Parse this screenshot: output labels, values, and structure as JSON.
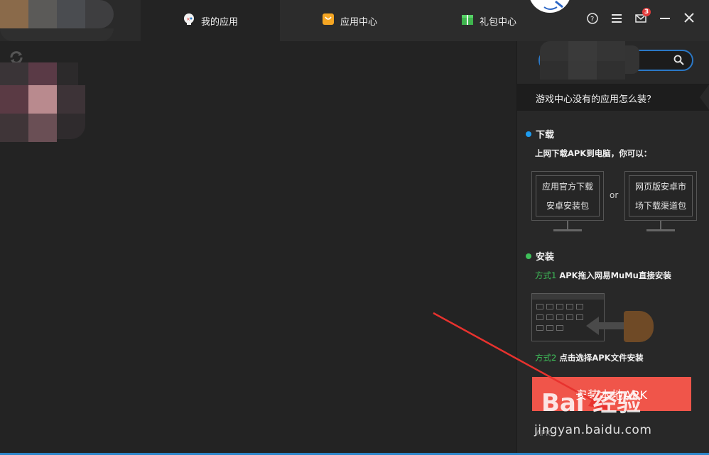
{
  "tabs": {
    "my_apps": "我的应用",
    "app_center": "应用中心",
    "gifts": "礼包中心"
  },
  "window_controls": {
    "mail_count": "3"
  },
  "right_panel": {
    "help_banner": "游戏中心没有的应用怎么装？",
    "download": {
      "title": "下载",
      "dot_color": "#1e9cf0",
      "subtitle": "上网下载APK到电脑，你可以：",
      "option1_line1": "应用官方下载",
      "option1_line2": "安卓安装包",
      "or": "or",
      "option2_line1": "网页版安卓市",
      "option2_line2": "场下载渠道包"
    },
    "install": {
      "title": "安装",
      "dot_color": "#3fc05a",
      "method1_label": "方式1",
      "method1_text": "APK拖入网易MuMu直接安装",
      "method2_label": "方式2",
      "method2_text": "点击选择APK文件安装"
    },
    "install_button": "安装本地APK",
    "footnote": "APK"
  },
  "watermark": {
    "logo": "Bai 经验",
    "url": "jingyan.baidu.com"
  },
  "colors": {
    "accent_blue": "#2b78c6",
    "install_button": "#f0554a",
    "annotation_arrow": "#e8322e"
  }
}
